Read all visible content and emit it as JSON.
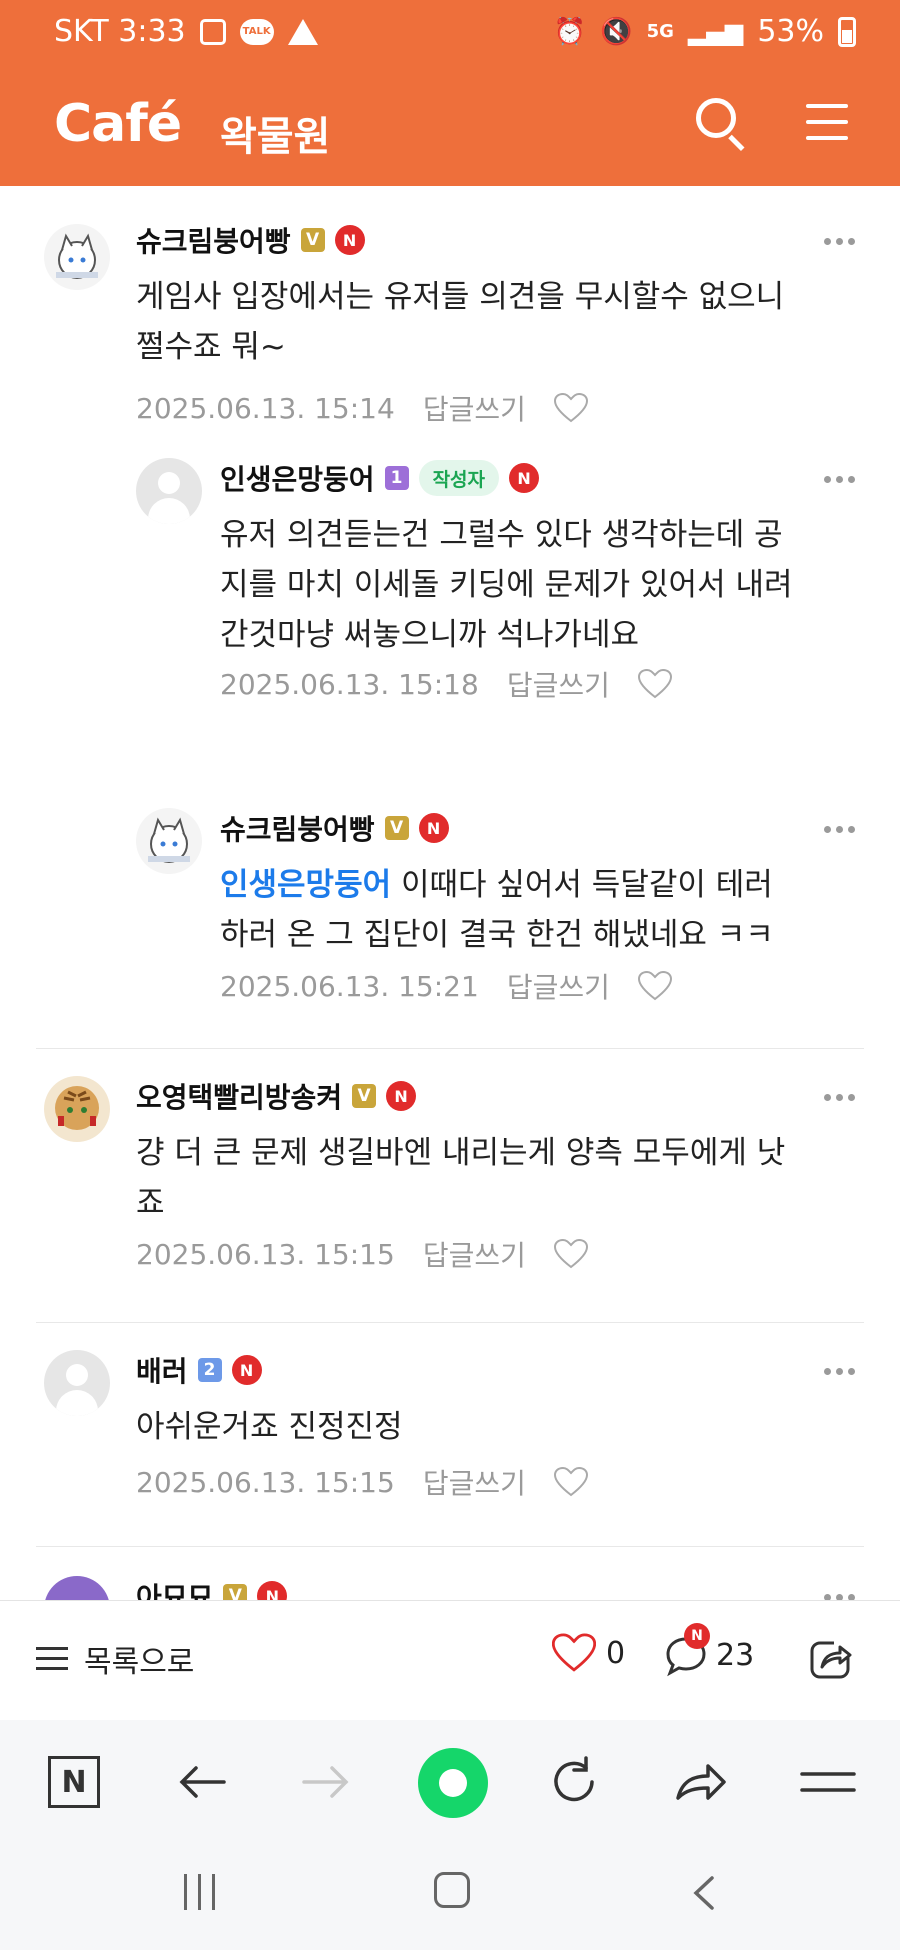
{
  "status_bar": {
    "carrier_time": "SKT 3:33",
    "talk_label": "TALK",
    "network": "5G",
    "battery": "53%"
  },
  "header": {
    "logo": "Café",
    "cafe_name": "왁물원"
  },
  "comments": [
    {
      "author": "슈크림붕어빵",
      "level_badge": "V",
      "new_badge": "N",
      "text": "게임사 입장에서는 유저들 의견을 무시할수 없으니 쩔수죠 뭐~",
      "line1": "게임사 입장에서는 유저들 의견을 무시할수 없으니",
      "line2": "쩔수죠 뭐~",
      "date": "2025.06.13. 15:14",
      "reply_label": "답글쓰기"
    },
    {
      "author": "인생은망둥어",
      "level_badge": "1",
      "writer_badge": "작성자",
      "new_badge": "N",
      "line1": "유저 의견듣는건 그럴수 있다 생각하는데 공",
      "line2": "지를 마치 이세돌 키딩에 문제가 있어서 내려",
      "line3": "간것마냥 써놓으니까 석나가네요",
      "date": "2025.06.13. 15:18",
      "reply_label": "답글쓰기"
    },
    {
      "author": "슈크림붕어빵",
      "level_badge": "V",
      "new_badge": "N",
      "mention": "인생은망둥어",
      "line1": " 이때다 싶어서 득달같이 테러",
      "line2": "하러 온 그 집단이 결국 한건 해냈네요 ㅋㅋ",
      "date": "2025.06.13. 15:21",
      "reply_label": "답글쓰기"
    },
    {
      "author": "오영택빨리방송켜",
      "level_badge": "V",
      "new_badge": "N",
      "line1": "걍 더 큰 문제 생길바엔 내리는게 양측 모두에게 낫",
      "line2": "죠",
      "date": "2025.06.13. 15:15",
      "reply_label": "답글쓰기"
    },
    {
      "author": "배러",
      "level_badge": "2",
      "new_badge": "N",
      "line1": "아쉬운거죠 진정진정",
      "date": "2025.06.13. 15:15",
      "reply_label": "답글쓰기"
    },
    {
      "author": "아묘묘",
      "level_badge": "V",
      "new_badge": "N"
    }
  ],
  "action_bar": {
    "to_list_label": "목록으로",
    "like_count": "0",
    "comment_count": "23",
    "comment_new_badge": "N"
  },
  "browser_nav": {
    "naver_label": "N"
  },
  "colors": {
    "brand_orange": "#ee6f3b",
    "mention_blue": "#1c7bea",
    "writer_green": "#1ba552",
    "new_red": "#e12b2b",
    "naver_green": "#15d66a"
  }
}
